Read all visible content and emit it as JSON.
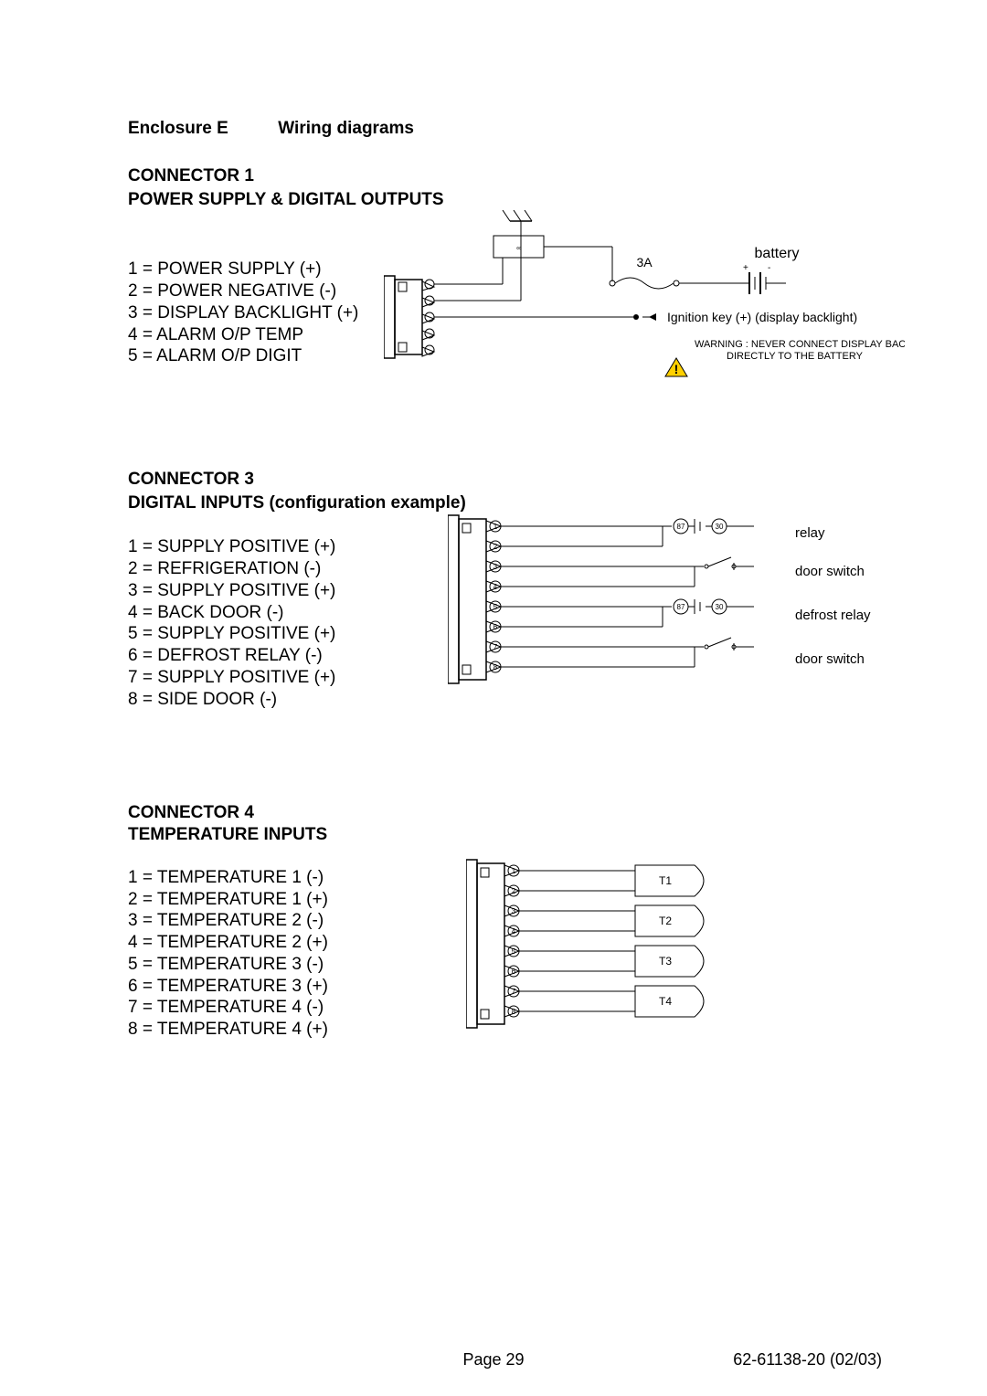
{
  "header": {
    "enclosure": "Enclosure E",
    "title": "Wiring diagrams"
  },
  "connector1": {
    "title1": "CONNECTOR 1",
    "title2": "POWER SUPPLY & DIGITAL OUTPUTS",
    "pins": {
      "p1": "1 = POWER SUPPLY (+)",
      "p2": "2 = POWER NEGATIVE (-)",
      "p3": "3 = DISPLAY BACKLIGHT (+)",
      "p4": "4 = ALARM O/P TEMP",
      "p5": "5 = ALARM O/P DIGIT"
    },
    "diagram": {
      "fuse": "3A",
      "battery_label": "battery",
      "ignition_label": "Ignition key (+) (display backlight)",
      "warning1": "WARNING : NEVER CONNECT DISPLAY BACKLIGHT",
      "warning2": "DIRECTLY TO THE BATTERY",
      "plus": "+",
      "minus": "-"
    }
  },
  "connector3": {
    "title1": "CONNECTOR 3",
    "title2": "DIGITAL INPUTS (configuration example)",
    "pins": {
      "p1": "1 = SUPPLY POSITIVE (+)",
      "p2": "2 = REFRIGERATION (-)",
      "p3": "3 = SUPPLY POSITIVE (+)",
      "p4": "4 = BACK DOOR (-)",
      "p5": "5 = SUPPLY POSITIVE (+)",
      "p6": "6 = DEFROST RELAY (-)",
      "p7": "7 = SUPPLY POSITIVE (+)",
      "p8": "8 = SIDE DOOR (-)"
    },
    "diagram": {
      "relay": "relay",
      "door_switch": "door switch",
      "defrost_relay": "defrost relay",
      "coil87": "87",
      "coil30": "30"
    }
  },
  "connector4": {
    "title1": "CONNECTOR 4",
    "title2": "TEMPERATURE INPUTS",
    "pins": {
      "p1": "1 = TEMPERATURE 1 (-)",
      "p2": "2 = TEMPERATURE 1 (+)",
      "p3": "3 = TEMPERATURE 2 (-)",
      "p4": "4 = TEMPERATURE 2 (+)",
      "p5": "5 = TEMPERATURE 3 (-)",
      "p6": "6 = TEMPERATURE 3 (+)",
      "p7": "7 = TEMPERATURE 4 (-)",
      "p8": "8 = TEMPERATURE 4 (+)"
    },
    "diagram": {
      "t1": "T1",
      "t2": "T2",
      "t3": "T3",
      "t4": "T4"
    }
  },
  "footer": {
    "page": "Page  29",
    "docid": "62-61138-20   (02/03)"
  }
}
